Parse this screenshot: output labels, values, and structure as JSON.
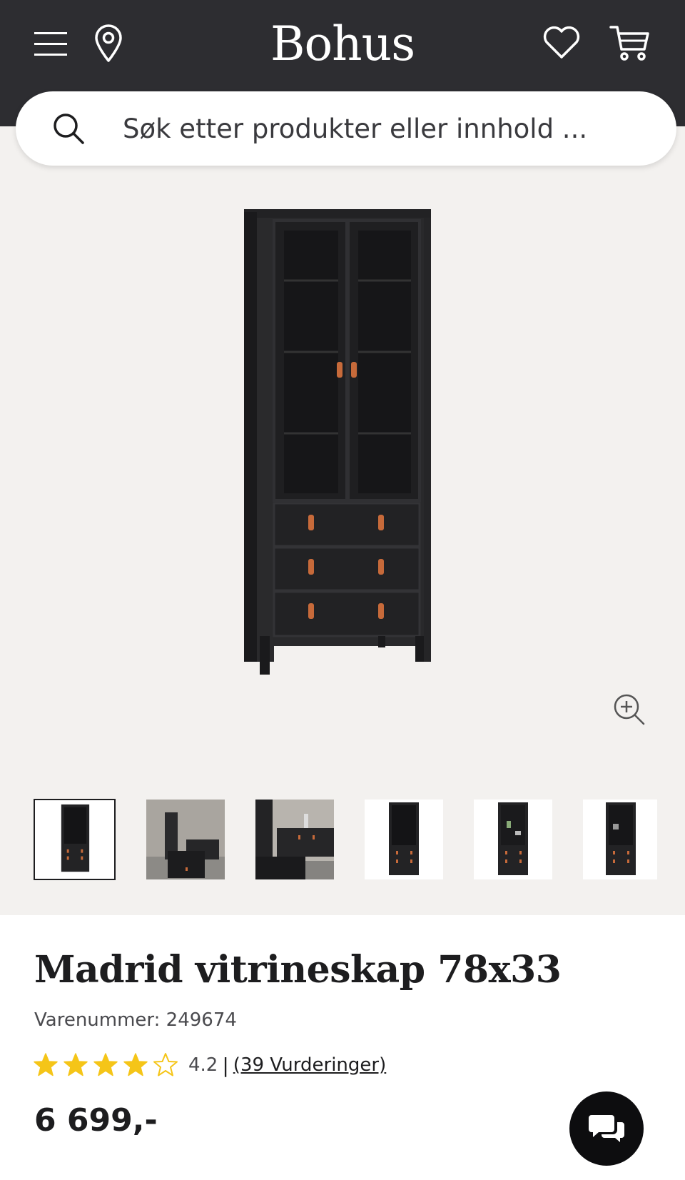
{
  "header": {
    "logo": "Bohus",
    "icons": {
      "menu": "hamburger-menu-icon",
      "location": "location-pin-icon",
      "favorites": "heart-icon",
      "cart": "shopping-cart-icon"
    }
  },
  "search": {
    "placeholder": "Søk etter produkter eller innhold ...",
    "value": "",
    "icon": "search-icon"
  },
  "gallery": {
    "zoom_icon": "zoom-in-icon",
    "thumbnail_count": 6,
    "active_thumbnail": 1,
    "thumbnails": [
      "studio-front",
      "living-room-scene",
      "room-closeup",
      "studio-front-2",
      "studio-open",
      "studio-side"
    ]
  },
  "product": {
    "title": "Madrid vitrineskap 78x33",
    "sku_text": "Varenummer: 249674",
    "rating_value": "4.2",
    "rating_stars": 4,
    "rating_max": 5,
    "separator": "|",
    "reviews_text": "(39 Vurderinger)",
    "price": "6 699,-"
  },
  "chat": {
    "icon": "chat-bubbles-icon"
  },
  "colors": {
    "header_bg": "#2d2d31",
    "gallery_bg": "#f3f1ef",
    "star": "#f5c518",
    "text": "#1d1d1f"
  }
}
